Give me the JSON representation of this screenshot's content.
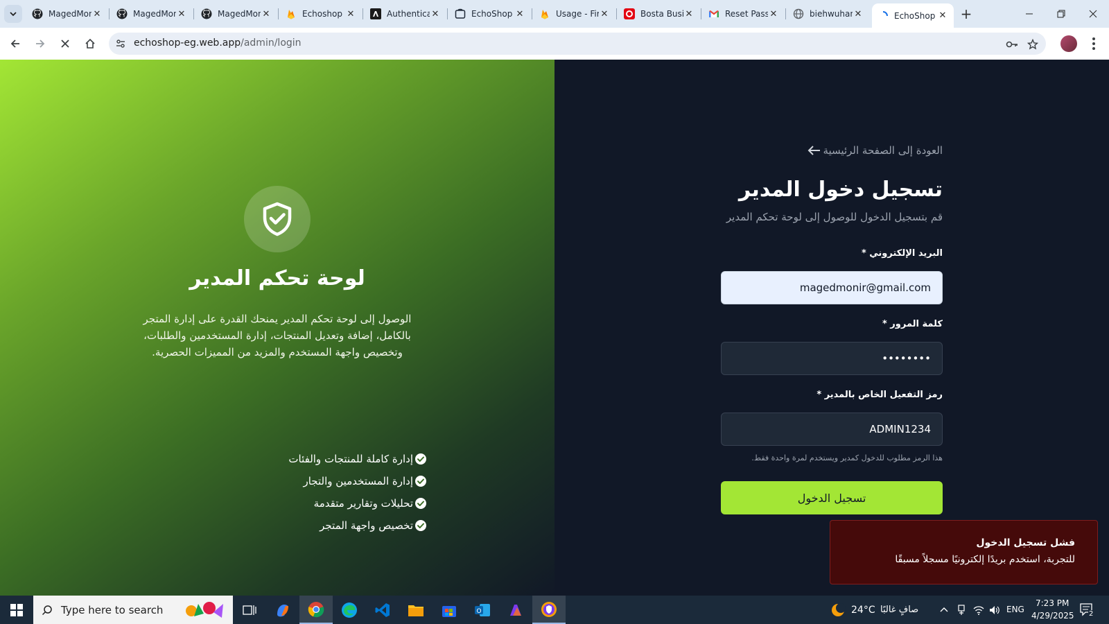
{
  "browser": {
    "tabs": [
      {
        "title": "MagedMonir",
        "icon": "github-icon"
      },
      {
        "title": "MagedMonir",
        "icon": "github-icon"
      },
      {
        "title": "MagedMonir",
        "icon": "github-icon"
      },
      {
        "title": "Echoshop",
        "icon": "firebase-icon"
      },
      {
        "title": "Authentication",
        "icon": "anthropic-icon"
      },
      {
        "title": "EchoShop",
        "icon": "shop-icon"
      },
      {
        "title": "Usage - Firebase",
        "icon": "firebase-icon"
      },
      {
        "title": "Bosta Business",
        "icon": "bosta-icon"
      },
      {
        "title": "Reset Password",
        "icon": "gmail-icon"
      },
      {
        "title": "biehwuhan",
        "icon": "globe-icon"
      },
      {
        "title": "EchoShop",
        "icon": "loading-icon"
      }
    ],
    "close_glyph": "✕",
    "new_tab_glyph": "+",
    "url_host": "echoshop-eg.web.app",
    "url_path": "/admin/login"
  },
  "left_panel": {
    "title": "لوحة تحكم المدير",
    "description": "الوصول إلى لوحة تحكم المدير يمنحك القدرة على إدارة المتجر بالكامل، إضافة وتعديل المنتجات، إدارة المستخدمين والطلبات، وتخصيص واجهة المستخدم والمزيد من المميزات الحصرية.",
    "features": [
      "إدارة كاملة للمنتجات والفئات",
      "إدارة المستخدمين والتجار",
      "تحليلات وتقارير متقدمة",
      "تخصيص واجهة المتجر"
    ]
  },
  "form": {
    "back_link": "العودة إلى الصفحة الرئيسية",
    "title": "تسجيل دخول المدير",
    "subtitle": "قم بتسجيل الدخول للوصول إلى لوحة تحكم المدير",
    "email_label": "البريد الإلكتروني *",
    "email_value": "magedmonir@gmail.com",
    "password_label": "كلمة المرور *",
    "password_value": "••••••••",
    "code_label": "رمز التفعيل الخاص بالمدير *",
    "code_value": "ADMIN1234",
    "code_hint": "هذا الرمز مطلوب للدخول كمدير ويستخدم لمرة واحدة فقط.",
    "submit_label": "تسجيل الدخول"
  },
  "toast": {
    "title": "فشل تسجيل الدخول",
    "message": "للتجربة، استخدم بريدًا إلكترونيًا مسجلاً مسبقًا"
  },
  "taskbar": {
    "search_placeholder": "Type here to search",
    "weather_temp": "24°C",
    "weather_text": "صافٍ غالبًا",
    "language": "ENG",
    "time": "7:23 PM",
    "date": "4/29/2025",
    "notification_count": "2"
  },
  "colors": {
    "accent_green": "#a3e635",
    "page_dark": "#111827",
    "toast_bg": "#450a0a"
  }
}
